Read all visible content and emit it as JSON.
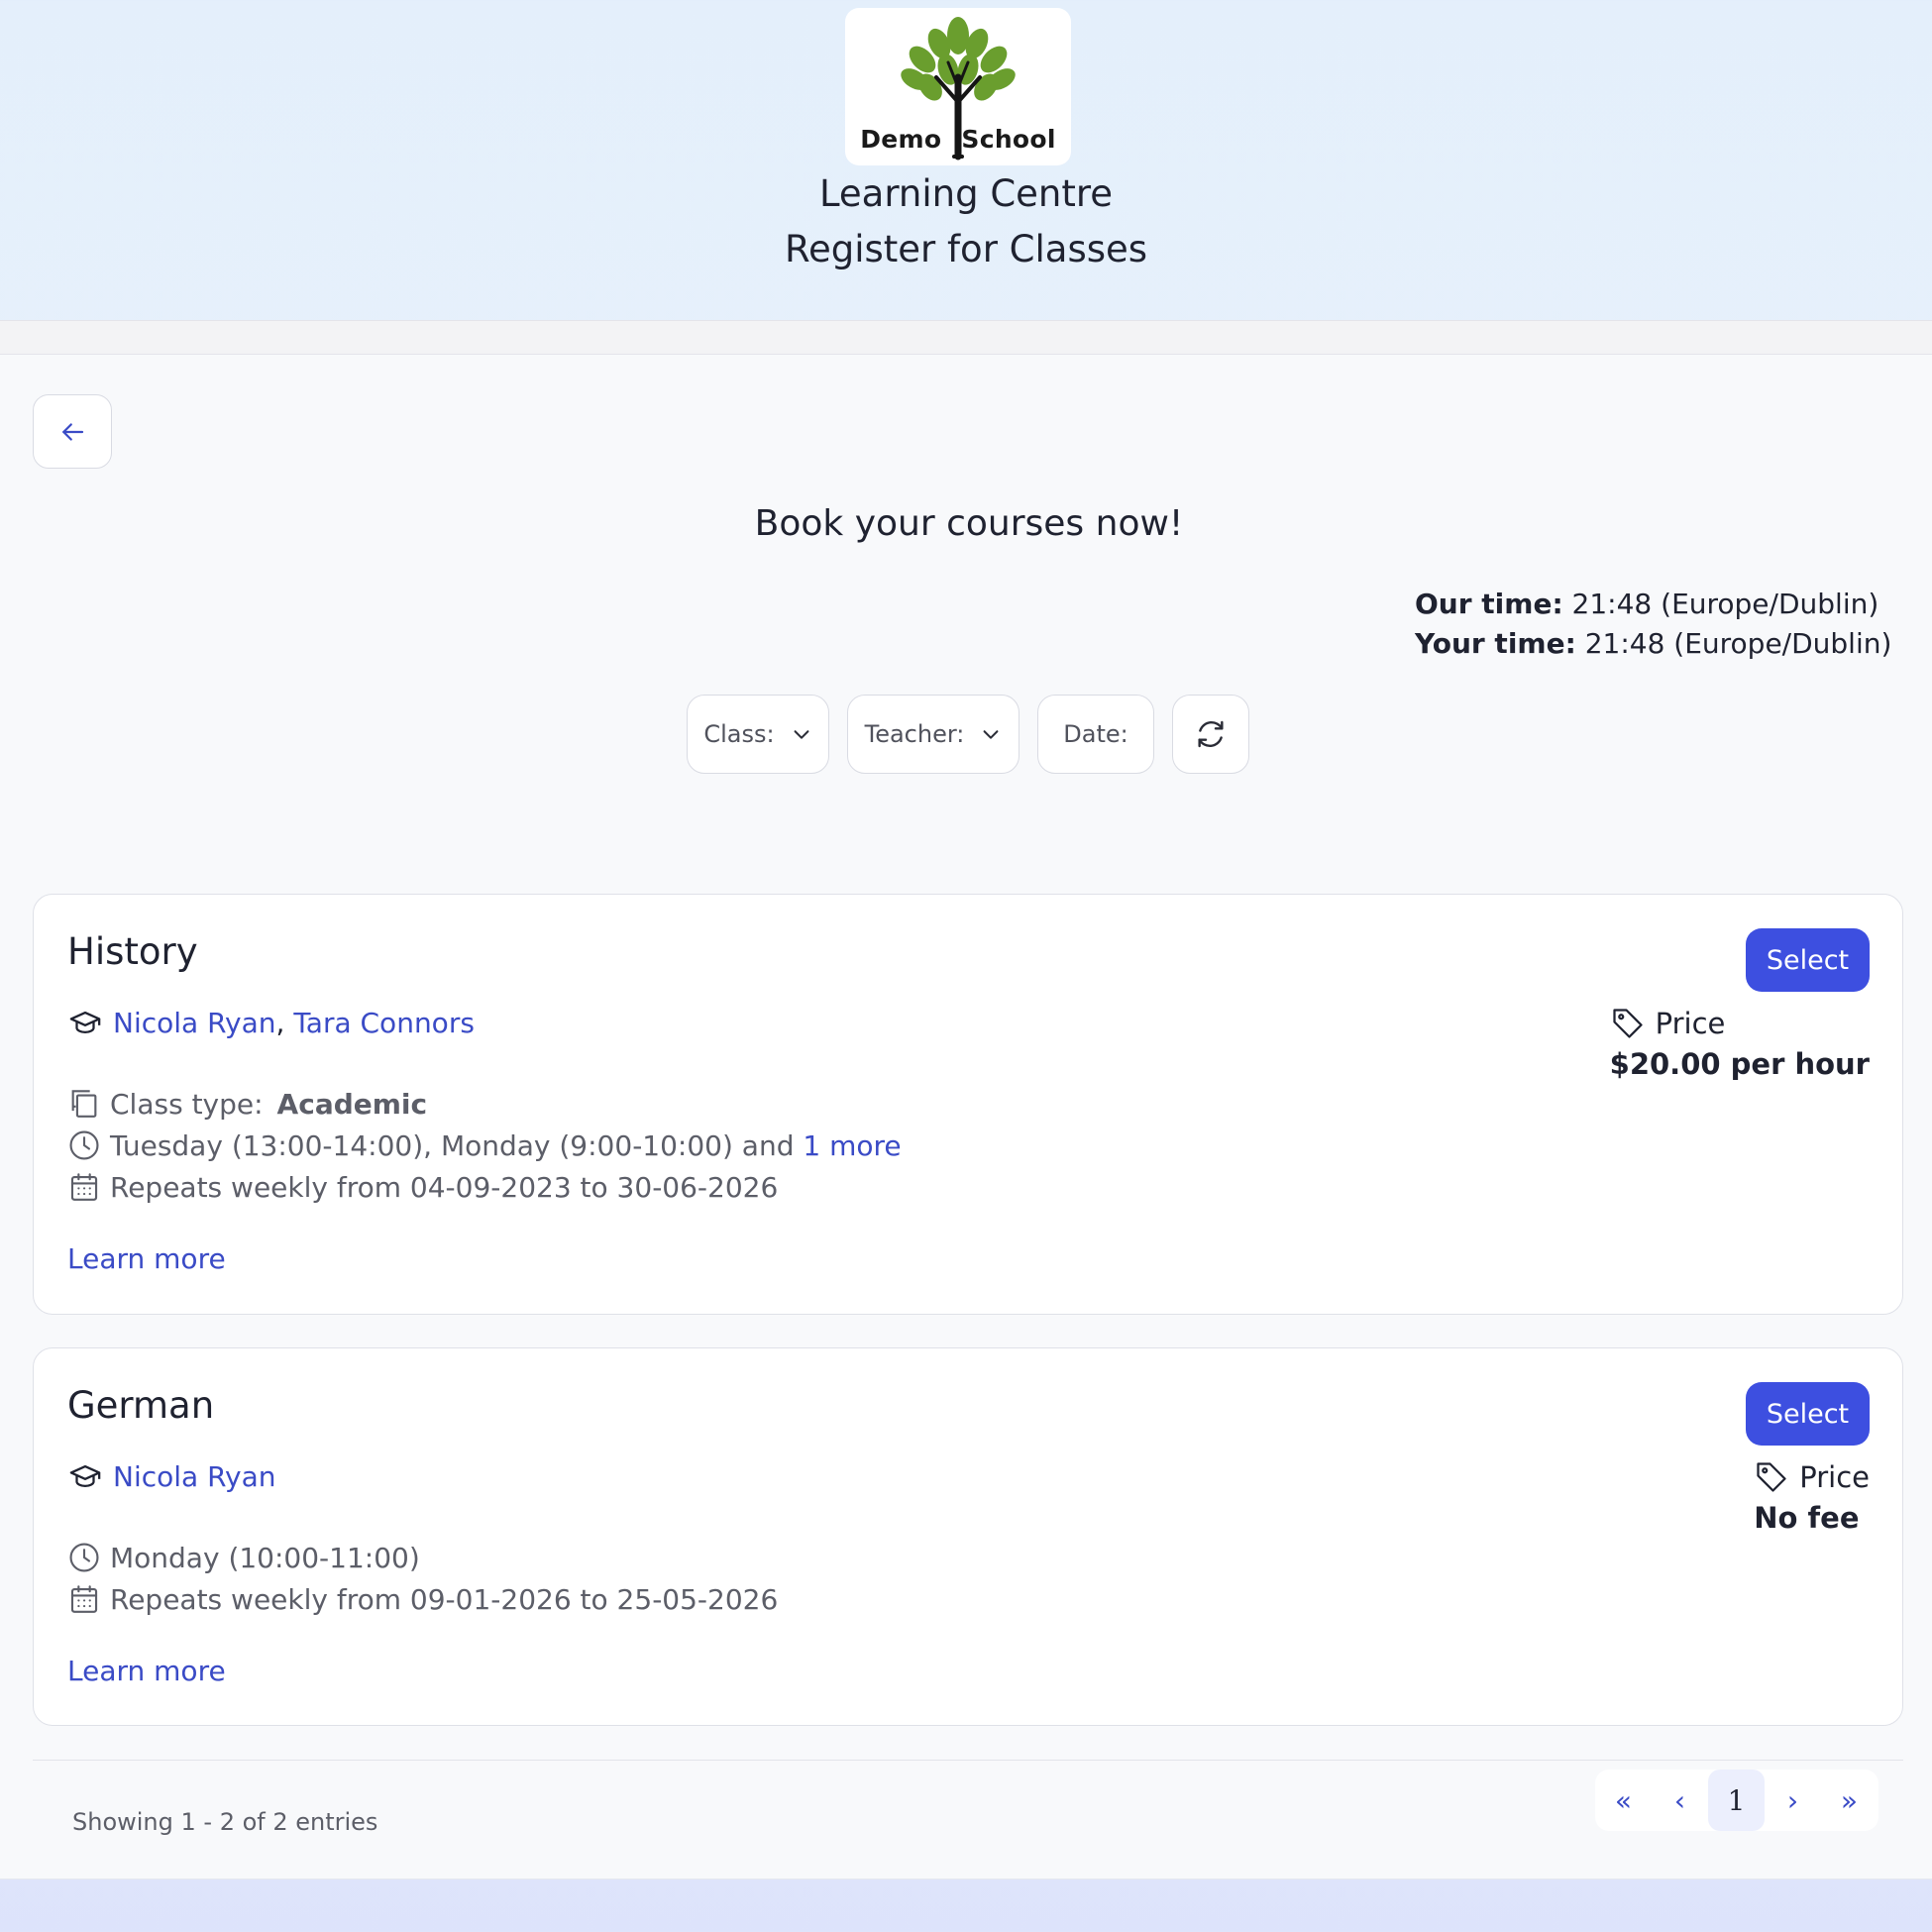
{
  "header": {
    "logo": {
      "word1": "Demo",
      "word2": "School"
    },
    "title": "Learning Centre",
    "subtitle": "Register for Classes"
  },
  "main": {
    "heading": "Book your courses now!",
    "times": {
      "our_label": "Our time:",
      "our_value": "21:48 (Europe/Dublin)",
      "your_label": "Your time:",
      "your_value": "21:48 (Europe/Dublin)"
    },
    "filters": {
      "class_label": "Class:",
      "teacher_label": "Teacher:",
      "date_label": "Date:"
    },
    "courses": [
      {
        "title": "History",
        "select_label": "Select",
        "teachers": [
          "Nicola Ryan",
          "Tara Connors"
        ],
        "teacher_sep": ",",
        "class_type_label": "Class type:",
        "class_type_value": "Academic",
        "schedule": "Tuesday (13:00-14:00), Monday (9:00-10:00) and",
        "schedule_more": "1 more",
        "repeats": "Repeats weekly from 04-09-2023 to 30-06-2026",
        "price_label": "Price",
        "price_value": "$20.00 per hour",
        "learn_more": "Learn more"
      },
      {
        "title": "German",
        "select_label": "Select",
        "teachers": [
          "Nicola Ryan"
        ],
        "schedule": "Monday (10:00-11:00)",
        "repeats": "Repeats weekly from 09-01-2026 to 25-05-2026",
        "price_label": "Price",
        "price_value": "No fee",
        "learn_more": "Learn more"
      }
    ]
  },
  "footer": {
    "showing": "Showing 1 - 2 of 2 entries",
    "pagination": {
      "first": "«",
      "prev": "‹",
      "current": "1",
      "next": "›",
      "last": "»"
    }
  },
  "colors": {
    "accent": "#3d4fe0",
    "link": "#3a4bc6",
    "logo_leaf": "#6a9e2e"
  },
  "icons": [
    "tree-logo",
    "arrow-left-icon",
    "chevron-down-icon",
    "refresh-icon",
    "graduation-cap-icon",
    "class-type-icon",
    "clock-icon",
    "calendar-icon",
    "tag-icon"
  ]
}
